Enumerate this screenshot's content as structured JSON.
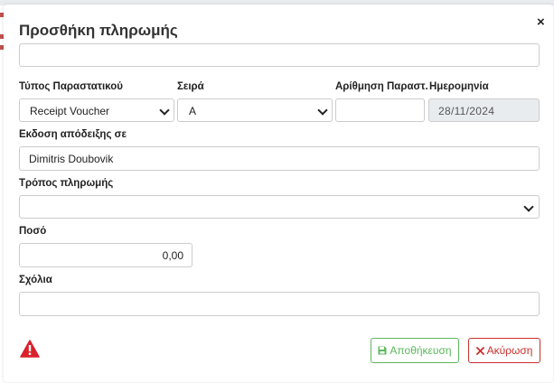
{
  "modal": {
    "title": "Προσθήκη πληρωμής",
    "close_glyph": "×"
  },
  "top_field": {
    "value": ""
  },
  "doc_type": {
    "label": "Τύπος Παραστατικού",
    "value": "Receipt Voucher"
  },
  "series": {
    "label": "Σειρά",
    "value": "A"
  },
  "number": {
    "label": "Αρίθμηση Παραστ.",
    "value": ""
  },
  "date": {
    "label": "Ημερομηνία",
    "value": "28/11/2024"
  },
  "issued_to": {
    "label": "Εκδοση απόδειξης σε",
    "value": "Dimitris Doubovik"
  },
  "payment_method": {
    "label": "Τρόπος πληρωμής",
    "value": ""
  },
  "amount": {
    "label": "Ποσό",
    "value": "0,00"
  },
  "comments": {
    "label": "Σχόλια",
    "value": ""
  },
  "buttons": {
    "save": "Αποθήκευση",
    "cancel": "Ακύρωση"
  },
  "colors": {
    "save": "#5cb85c",
    "cancel": "#c9302c",
    "warning": "#d9212c",
    "readonly_bg": "#e9ecef"
  },
  "icons": {
    "warning": "warning-triangle-icon",
    "save": "floppy-disk-icon",
    "cancel": "x-icon",
    "dropdown": "chevron-down-icon"
  }
}
